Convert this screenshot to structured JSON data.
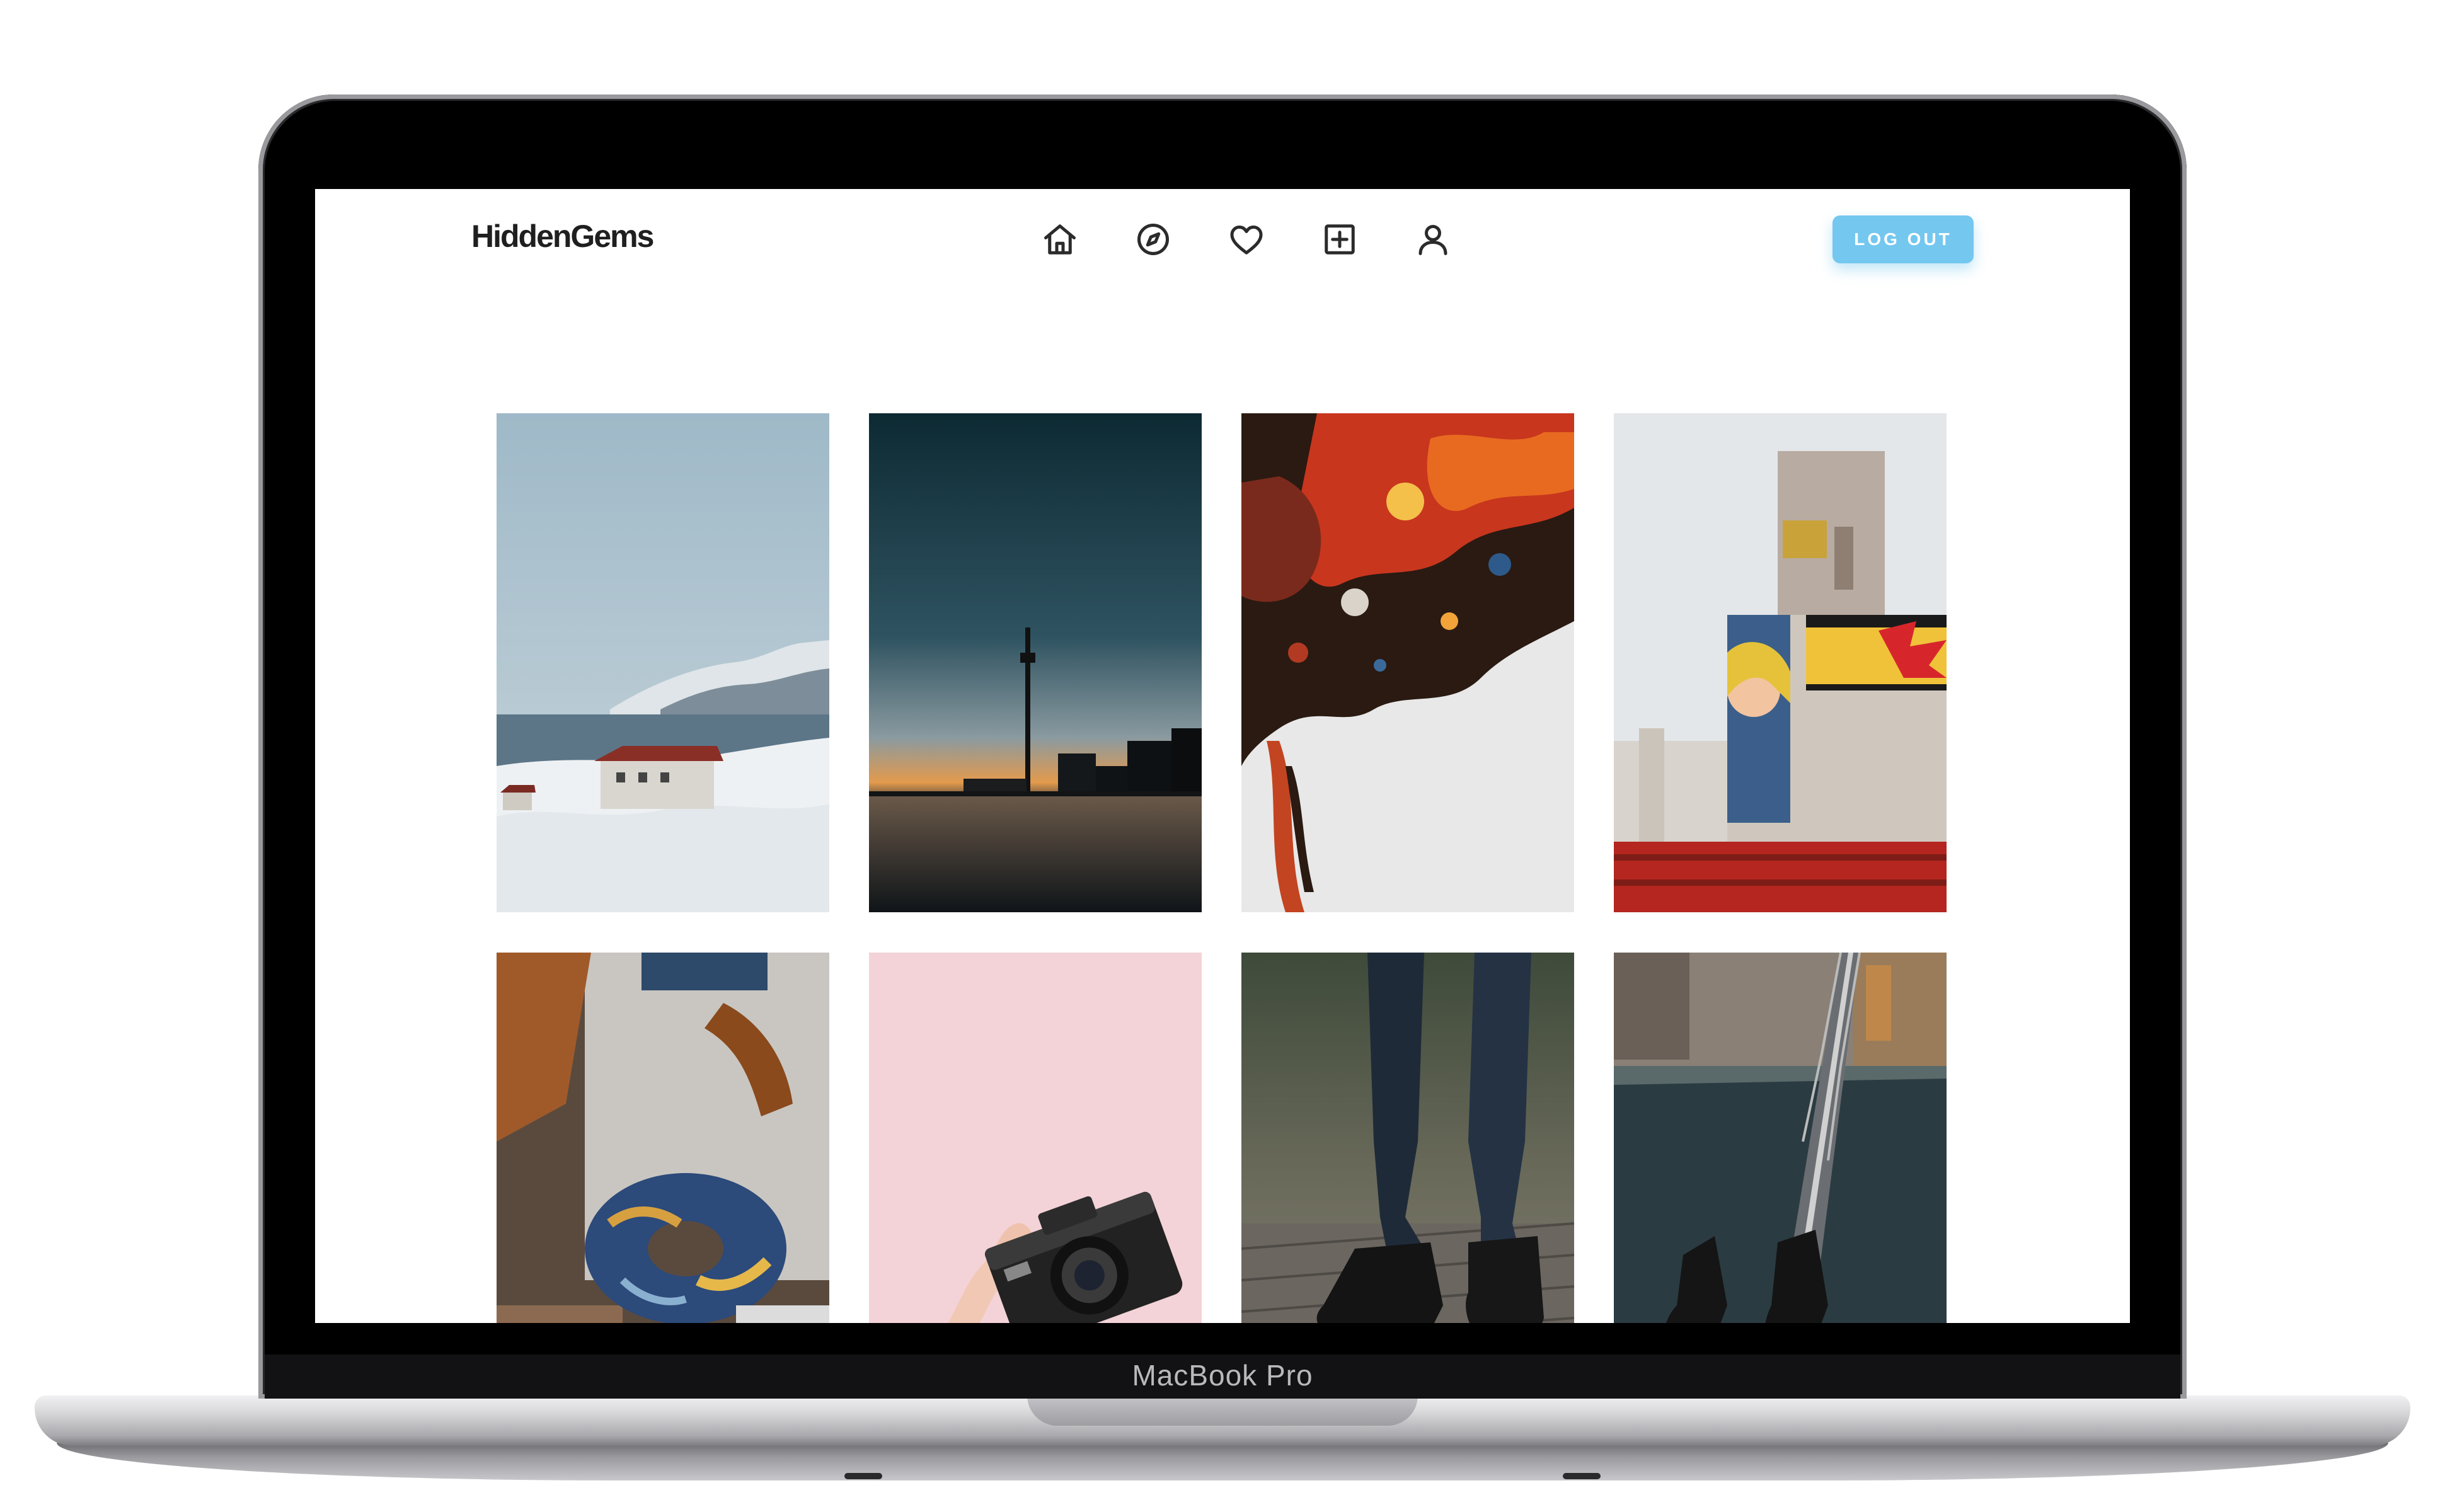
{
  "device": {
    "model_label": "MacBook Pro"
  },
  "app": {
    "brand": "HiddenGems",
    "nav": [
      {
        "icon": "home-icon"
      },
      {
        "icon": "compass-icon"
      },
      {
        "icon": "heart-icon"
      },
      {
        "icon": "add-square-icon"
      },
      {
        "icon": "user-icon"
      }
    ],
    "logout_label": "LOG OUT",
    "accent_color": "#74c7ef"
  },
  "gallery": {
    "photos": [
      {
        "subject": "snowy-coast-house"
      },
      {
        "subject": "sunset-observation-tower"
      },
      {
        "subject": "abstract-fluid-paint"
      },
      {
        "subject": "pop-art-building"
      },
      {
        "subject": "starry-night-scrunchie"
      },
      {
        "subject": "hand-holding-camera"
      },
      {
        "subject": "jeans-and-sneakers"
      },
      {
        "subject": "bridge-aerial-feet"
      }
    ]
  }
}
